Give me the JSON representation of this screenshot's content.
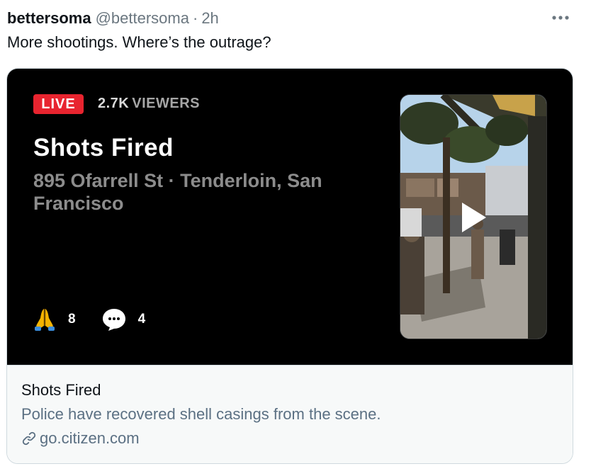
{
  "tweet": {
    "author_name": "bettersoma",
    "author_handle": "@bettersoma",
    "separator": "·",
    "timestamp": "2h",
    "text": "More shootings. Where’s the outrage?"
  },
  "card": {
    "live_label": "LIVE",
    "viewer_count": "2.7K",
    "viewer_label": "VIEWERS",
    "incident_title": "Shots Fired",
    "incident_address": "895 Ofarrell St · Tenderloin, San Francisco",
    "reactions": [
      {
        "icon": "praying-hands-icon",
        "count": "8"
      },
      {
        "icon": "comment-bubble-icon",
        "count": "4"
      }
    ],
    "footer_title": "Shots Fired",
    "footer_description": "Police have recovered shell casings from the scene.",
    "footer_domain": "go.citizen.com"
  },
  "colors": {
    "live_red": "#e8242f",
    "link_gray": "#5b7083",
    "card_bg": "#000000"
  }
}
